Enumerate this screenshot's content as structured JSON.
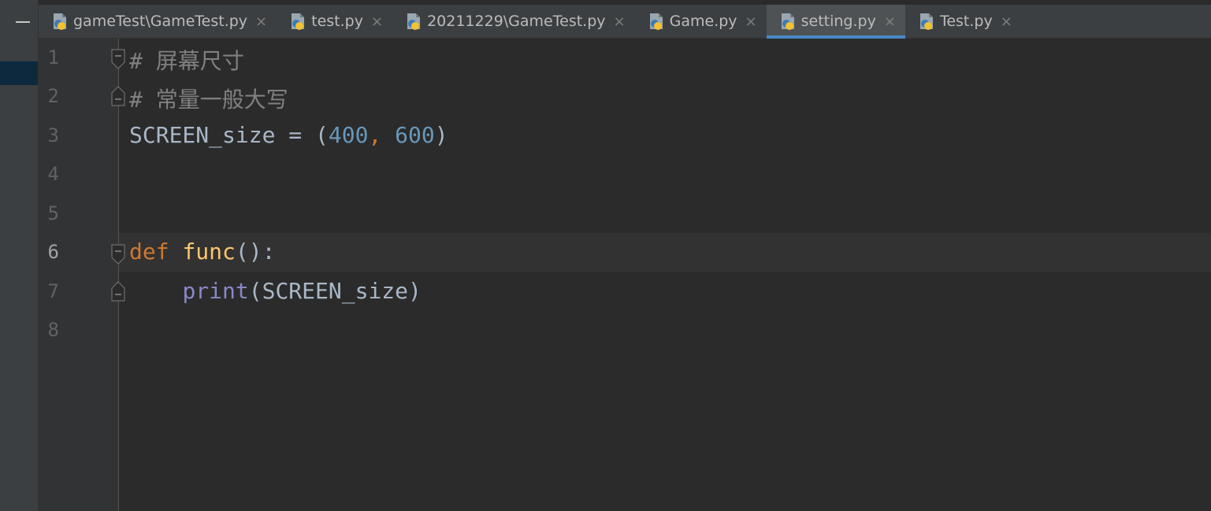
{
  "tabs": [
    {
      "label": "gameTest\\GameTest.py",
      "active": false
    },
    {
      "label": "test.py",
      "active": false
    },
    {
      "label": "20211229\\GameTest.py",
      "active": false
    },
    {
      "label": "Game.py",
      "active": false
    },
    {
      "label": "setting.py",
      "active": true
    },
    {
      "label": "Test.py",
      "active": false
    }
  ],
  "close_glyph": "×",
  "line_numbers": [
    "1",
    "2",
    "3",
    "4",
    "5",
    "6",
    "7",
    "8"
  ],
  "code": {
    "line1": {
      "comment": "# 屏幕尺寸"
    },
    "line2": {
      "comment": "# 常量一般大写"
    },
    "line3": {
      "var": "SCREEN_size",
      "eq": " = ",
      "open": "(",
      "n1": "400",
      "comma": ", ",
      "n2": "600",
      "close": ")"
    },
    "line6": {
      "kw": "def",
      "space": " ",
      "fn": "func",
      "rest": "():"
    },
    "line7": {
      "indent": "    ",
      "builtin": "print",
      "args": "(SCREEN_size)"
    }
  },
  "icons": {
    "python_file": "python-file-icon",
    "fold": "fold-icon",
    "minimize": "minimize-icon"
  },
  "colors": {
    "background": "#2b2b2b",
    "keyword": "#cc7832",
    "function": "#ffc66d",
    "number": "#6897bb",
    "comment": "#808080",
    "builtin": "#8888c6",
    "active_tab_underline": "#4a88c7"
  }
}
